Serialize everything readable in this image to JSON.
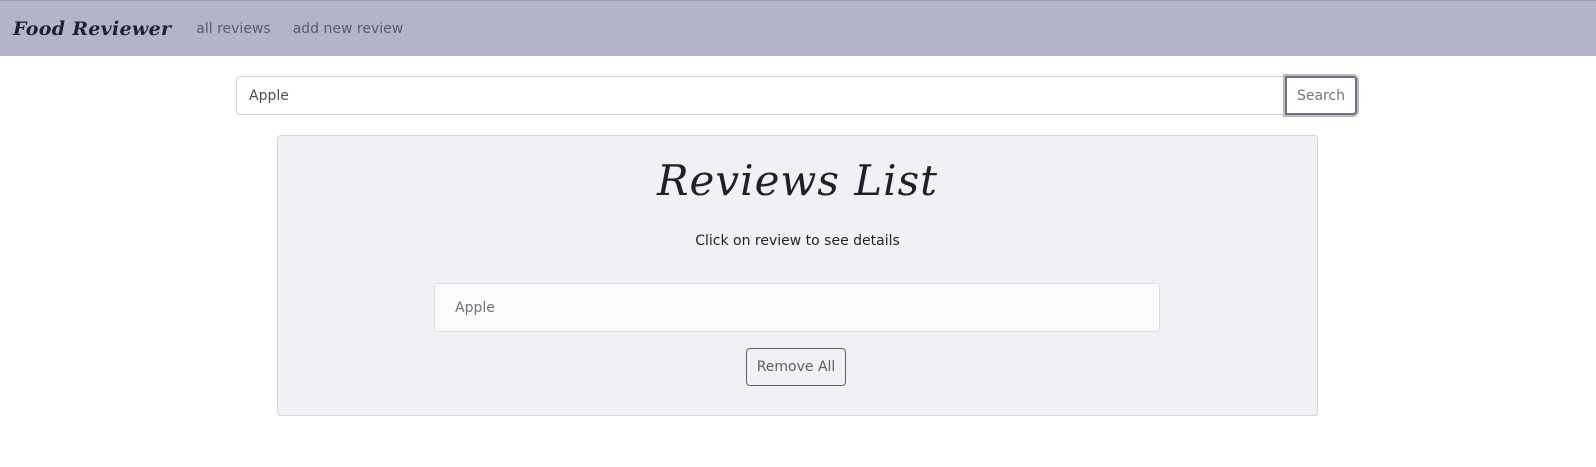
{
  "navbar": {
    "brand": "Food Reviewer",
    "links": [
      {
        "label": "all reviews"
      },
      {
        "label": "add new review"
      }
    ],
    "background": "#b3b3cc"
  },
  "search": {
    "value": "Apple",
    "button_label": "Search"
  },
  "panel": {
    "title": "Reviews List",
    "hint": "Click on review to see details",
    "items": [
      {
        "label": "Apple"
      }
    ],
    "remove_all_label": "Remove All",
    "background": "#f0f0f5"
  }
}
